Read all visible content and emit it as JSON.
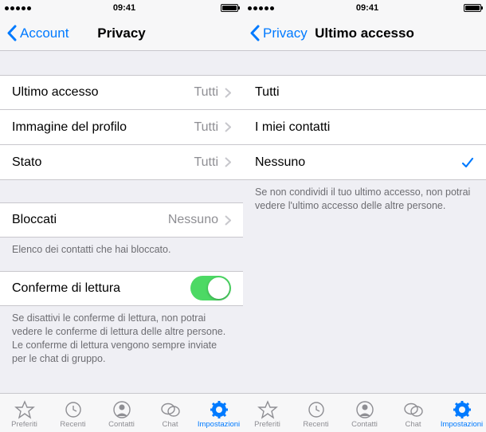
{
  "statusbar": {
    "time": "09:41"
  },
  "left": {
    "nav": {
      "back": "Account",
      "title": "Privacy"
    },
    "rows": {
      "last_seen": {
        "label": "Ultimo accesso",
        "value": "Tutti"
      },
      "profile_pic": {
        "label": "Immagine del profilo",
        "value": "Tutti"
      },
      "status": {
        "label": "Stato",
        "value": "Tutti"
      },
      "blocked": {
        "label": "Bloccati",
        "value": "Nessuno"
      },
      "read": {
        "label": "Conferme di lettura"
      }
    },
    "blocked_footer": "Elenco dei contatti che hai bloccato.",
    "read_footer": "Se disattivi le conferme di lettura, non potrai vedere le conferme di lettura delle altre persone. Le conferme di lettura vengono sempre inviate per le chat di gruppo."
  },
  "right": {
    "nav": {
      "back": "Privacy",
      "title": "Ultimo accesso"
    },
    "options": {
      "everyone": "Tutti",
      "contacts": "I miei contatti",
      "nobody": "Nessuno"
    },
    "footer": "Se non condividi il tuo ultimo accesso, non potrai vedere l'ultimo accesso delle altre persone."
  },
  "tabs": {
    "favorites": "Preferiti",
    "recents": "Recenti",
    "contacts": "Contatti",
    "chats": "Chat",
    "settings": "Impostazioni"
  }
}
